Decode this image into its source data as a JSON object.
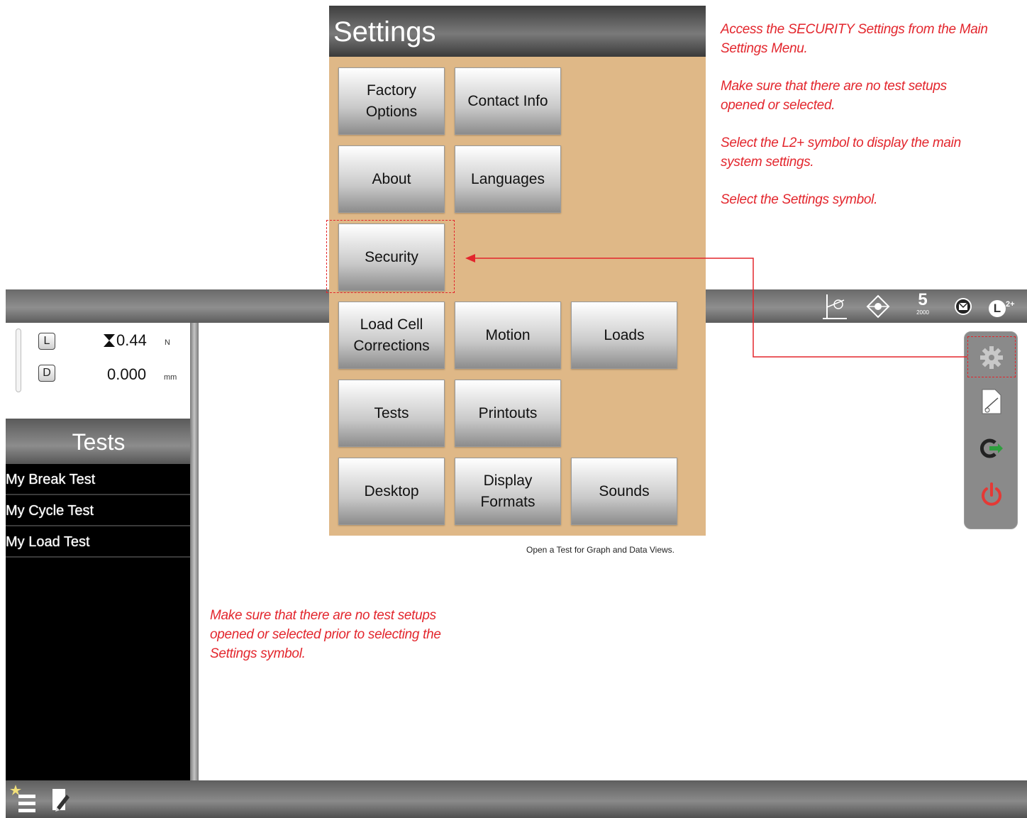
{
  "settings": {
    "title": "Settings",
    "buttons": {
      "factory_options": "Factory\nOptions",
      "contact_info": "Contact Info",
      "about": "About",
      "languages": "Languages",
      "security": "Security",
      "load_cell_corrections": "Load Cell\nCorrections",
      "motion": "Motion",
      "loads": "Loads",
      "tests": "Tests",
      "printouts": "Printouts",
      "desktop": "Desktop",
      "display_formats": "Display\nFormats",
      "sounds": "Sounds"
    }
  },
  "topbar": {
    "digit_main": "5",
    "digit_sub": "2000",
    "level": "L",
    "level_sup": "2+"
  },
  "readout": {
    "load_tag": "L",
    "load_value": "0.44",
    "load_unit": "N",
    "disp_tag": "D",
    "disp_value": "0.000",
    "disp_unit": "mm"
  },
  "tests_panel": {
    "header": "Tests",
    "items": [
      "My Break Test",
      "My Cycle Test",
      "My Load Test"
    ]
  },
  "main": {
    "placeholder": "Open a Test for Graph and Data Views."
  },
  "annotations": {
    "right_notes": [
      "Access the SECURITY Settings from the Main Settings Menu.",
      "Make sure that there are no test setups opened or selected.",
      "Select the L2+ symbol to display the main system settings.",
      "Select the Settings symbol."
    ],
    "bottom_note": "Make sure that there are no test setups opened or selected prior to selecting the Settings symbol."
  },
  "colors": {
    "settings_bg": "#dfb887",
    "annotation": "#e3262d",
    "power_icon": "#e53935",
    "logout_arrow": "#2e9e3e"
  }
}
